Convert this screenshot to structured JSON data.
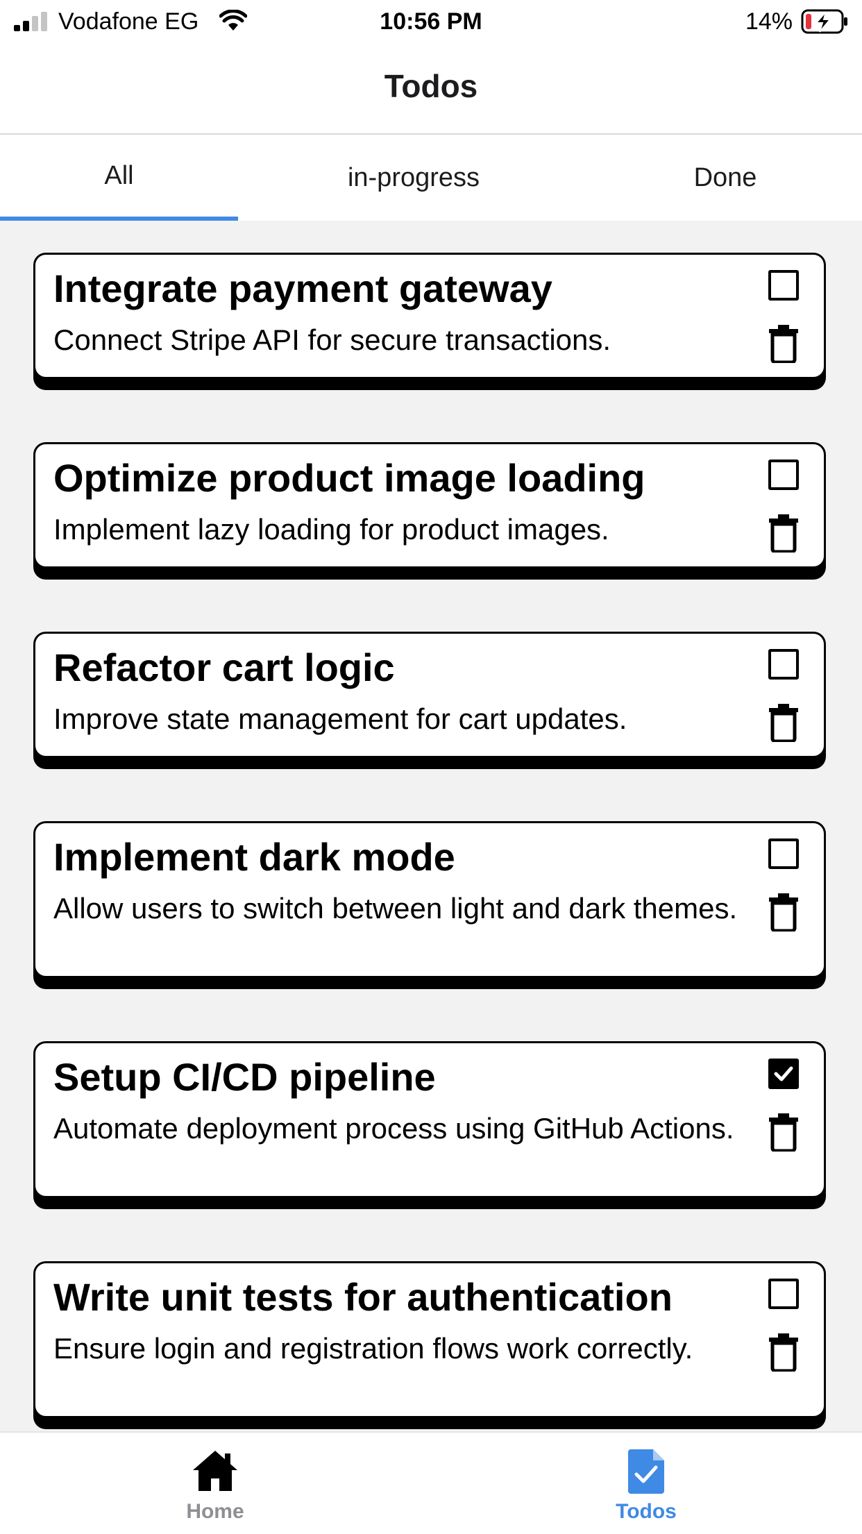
{
  "status_bar": {
    "carrier": "Vodafone EG",
    "time": "10:56 PM",
    "battery": "14%"
  },
  "header": {
    "title": "Todos"
  },
  "tabs": [
    {
      "label": "All",
      "active": true
    },
    {
      "label": "in-progress",
      "active": false
    },
    {
      "label": "Done",
      "active": false
    }
  ],
  "todos": [
    {
      "title": "Integrate payment gateway",
      "description": "Connect Stripe API for secure transactions.",
      "done": false
    },
    {
      "title": "Optimize product image loading",
      "description": "Implement lazy loading for product images.",
      "done": false
    },
    {
      "title": "Refactor cart logic",
      "description": "Improve state management for cart updates.",
      "done": false
    },
    {
      "title": "Implement dark mode",
      "description": "Allow users to switch between light and dark themes.",
      "done": false
    },
    {
      "title": "Setup CI/CD pipeline",
      "description": "Automate deployment process using GitHub Actions.",
      "done": true
    },
    {
      "title": "Write unit tests for authentication",
      "description": "Ensure login and registration flows work correctly.",
      "done": false
    }
  ],
  "tab_bar": [
    {
      "label": "Home",
      "icon": "home-icon",
      "active": false
    },
    {
      "label": "Todos",
      "icon": "todo-file-icon",
      "active": true
    }
  ],
  "colors": {
    "accent": "#3f8ae4",
    "inactive": "#8e8e93",
    "background": "#f2f2f2",
    "battery_low": "#e5333b"
  }
}
